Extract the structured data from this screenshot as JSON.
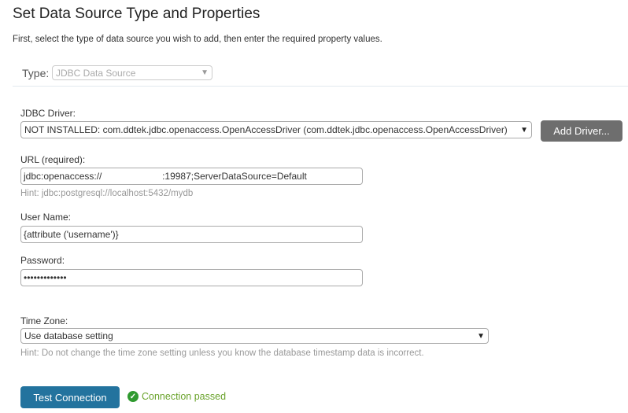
{
  "header": {
    "title": "Set Data Source Type and Properties",
    "subtitle": "First, select the type of data source you wish to add, then enter the required property values."
  },
  "type": {
    "label": "Type:",
    "value": "JDBC Data Source"
  },
  "driver": {
    "label": "JDBC Driver:",
    "value": "NOT INSTALLED: com.ddtek.jdbc.openaccess.OpenAccessDriver (com.ddtek.jdbc.openaccess.OpenAccessDriver)",
    "add_label": "Add Driver..."
  },
  "url": {
    "label": "URL (required):",
    "value": "jdbc:openaccess://                       :19987;ServerDataSource=Default",
    "hint": "Hint: jdbc:postgresql://localhost:5432/mydb"
  },
  "username": {
    "label": "User Name:",
    "value": "{attribute ('username')}"
  },
  "password": {
    "label": "Password:",
    "value": "•••••••••••••"
  },
  "timezone": {
    "label": "Time Zone:",
    "value": "Use database setting",
    "hint": "Hint: Do not change the time zone setting unless you know the database timestamp data is incorrect."
  },
  "test": {
    "button_label": "Test Connection",
    "status": "Connection passed",
    "status_color": "#6aa32c"
  }
}
